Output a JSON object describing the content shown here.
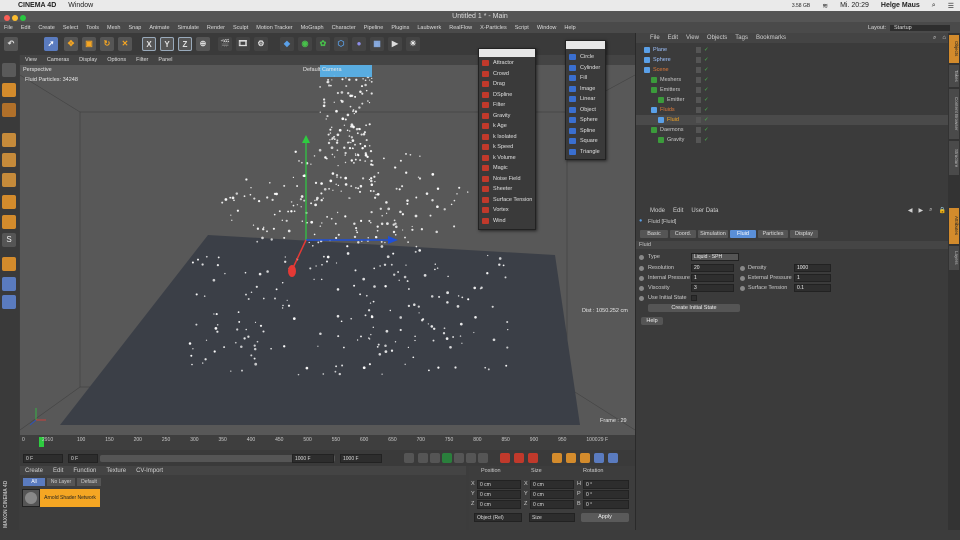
{
  "mac_menubar": {
    "apple": "",
    "app_name": "CINEMA 4D",
    "window_menu": "Window",
    "status": "Mi. 20:29",
    "user": "Helge Maus",
    "memory": "3.58 GB"
  },
  "window": {
    "title": "Untitled 1 * - Main",
    "layout_label": "Layout:",
    "layout_value": "Startup"
  },
  "app_menu": [
    "File",
    "Edit",
    "Create",
    "Select",
    "Tools",
    "Mesh",
    "Snap",
    "Animate",
    "Simulate",
    "Render",
    "Sculpt",
    "Motion Tracker",
    "MoGraph",
    "Character",
    "Pipeline",
    "Plugins",
    "Laubwerk",
    "RealFlow",
    "X-Particles",
    "Script",
    "Window",
    "Help"
  ],
  "toolbar": {
    "axis_x": "X",
    "axis_y": "Y",
    "axis_z": "Z"
  },
  "viewport_menu": [
    "View",
    "Cameras",
    "Display",
    "Options",
    "Filter",
    "Panel"
  ],
  "viewport": {
    "label": "Perspective",
    "camera": "Default Camera",
    "fluid_info": "Fluid  Particles: 34248",
    "distance": "Dist : 1050.252 cm",
    "frame": "Frame : 29"
  },
  "timeline": {
    "ticks": [
      "0",
      "2910",
      "100",
      "150",
      "200",
      "250",
      "300",
      "350",
      "400",
      "450",
      "500",
      "550",
      "600",
      "650",
      "700",
      "750",
      "800",
      "850",
      "900",
      "950",
      "1000"
    ],
    "end_frame": "29 F",
    "current_frame": "0 F",
    "min_field": "0 F",
    "max_field": "1000 F",
    "max_field2": "1000 F",
    "progress": 0.029
  },
  "material_manager": {
    "menu": [
      "Create",
      "Edit",
      "Function",
      "Texture",
      "CV-Import"
    ],
    "filters": [
      "All",
      "No Layer",
      "Default"
    ],
    "material_name": "Arnold Shader Network",
    "brand": "MAXON CINEMA 4D"
  },
  "coord_manager": {
    "headers": [
      "Position",
      "Size",
      "Rotation"
    ],
    "rows": [
      {
        "axis": "X",
        "pos": "0 cm",
        "size_axis": "X",
        "size": "0 cm",
        "rot_axis": "H",
        "rot": "0 °"
      },
      {
        "axis": "Y",
        "pos": "0 cm",
        "size_axis": "Y",
        "size": "0 cm",
        "rot_axis": "P",
        "rot": "0 °"
      },
      {
        "axis": "Z",
        "pos": "0 cm",
        "size_axis": "Z",
        "size": "0 cm",
        "rot_axis": "B",
        "rot": "0 °"
      }
    ],
    "mode_object": "Object (Rel)",
    "mode_size": "Size",
    "apply_label": "Apply"
  },
  "object_manager": {
    "menu": [
      "File",
      "Edit",
      "View",
      "Objects",
      "Tags",
      "Bookmarks"
    ],
    "objects": [
      {
        "name": "Plane",
        "color": "#9ec3ff",
        "indent": 0
      },
      {
        "name": "Sphere",
        "color": "#9ec3ff",
        "indent": 0
      },
      {
        "name": "Scene",
        "color": "#e07a3a",
        "indent": 0
      },
      {
        "name": "Meshers",
        "color": "#c8c8c8",
        "indent": 1
      },
      {
        "name": "Emitters",
        "color": "#c8c8c8",
        "indent": 1
      },
      {
        "name": "Emitter",
        "color": "#c8c8c8",
        "indent": 2
      },
      {
        "name": "Fluids",
        "color": "#e07a3a",
        "indent": 1
      },
      {
        "name": "Fluid",
        "color": "#f5a623",
        "indent": 2
      },
      {
        "name": "Daemons",
        "color": "#c8c8c8",
        "indent": 1
      },
      {
        "name": "Gravity",
        "color": "#c8c8c8",
        "indent": 2
      }
    ]
  },
  "attribute_manager": {
    "menu": [
      "Mode",
      "Edit",
      "User Data"
    ],
    "object_title": "Fluid [Fluid]",
    "tabs": [
      "Basic",
      "Coord.",
      "Simulation",
      "Fluid",
      "Particles",
      "Display"
    ],
    "active_tab": "Fluid",
    "section": "Fluid",
    "type_label": "Type",
    "type_value": "Liquid - SPH",
    "params_left": [
      {
        "label": "Resolution",
        "value": "20"
      },
      {
        "label": "Internal Pressure",
        "value": "1"
      },
      {
        "label": "Viscosity",
        "value": "3"
      }
    ],
    "params_right": [
      {
        "label": "Density",
        "value": "1000"
      },
      {
        "label": "External Pressure",
        "value": "1"
      },
      {
        "label": "Surface Tension",
        "value": "0.1"
      }
    ],
    "use_initial_state": "Use Initial State",
    "create_initial_state": "Create Initial State",
    "help": "Help"
  },
  "right_tabs": [
    "Objects",
    "Takes",
    "Content Browser",
    "Structure",
    "Attributes",
    "Layers"
  ],
  "popup_daemons": [
    "Attractor",
    "Crowd",
    "Drag",
    "DSpline",
    "Filter",
    "Gravity",
    "k Age",
    "k Isolated",
    "k Speed",
    "k Volume",
    "Magic",
    "Noise Field",
    "Sheeter",
    "Surface Tension",
    "Vortex",
    "Wind"
  ],
  "popup_emitters": [
    "Circle",
    "Cylinder",
    "Fill",
    "Image",
    "Linear",
    "Object",
    "Sphere",
    "Spline",
    "Square",
    "Triangle"
  ],
  "colors": {
    "accent": "#f5a623",
    "tab_active": "#5a8fd8",
    "bg": "#3c3c3c",
    "axis_x": "#e53935",
    "axis_y": "#43a047",
    "axis_z": "#1e4fd8"
  }
}
